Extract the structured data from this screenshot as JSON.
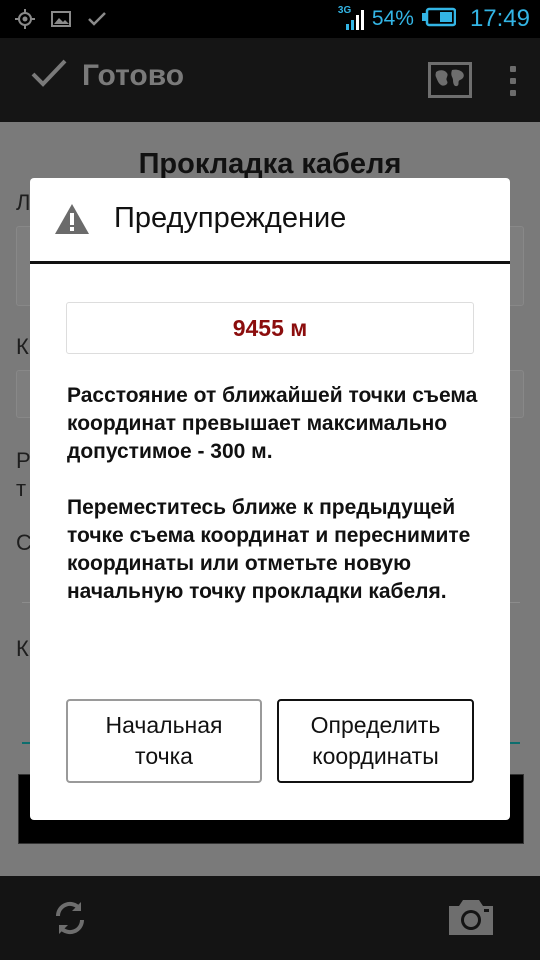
{
  "status_bar": {
    "icons": [
      "gps-icon",
      "image-icon",
      "check-icon"
    ],
    "network_label": "3G",
    "battery_percent": "54%",
    "time": "17:49",
    "accent_color": "#33b5e5"
  },
  "action_bar": {
    "done_label": "Готово",
    "map_icon": "world-map-icon",
    "more_icon": "overflow-menu-icon"
  },
  "form": {
    "title": "Прокладка кабеля",
    "label_fragments": [
      "Л",
      "К",
      "Р",
      "т",
      "С",
      "К"
    ]
  },
  "dialog": {
    "icon": "warning-icon",
    "title": "Предупреждение",
    "distance_value": "9455 м",
    "message_lines_1": "Расстояние от ближайшей точки съема координат превышает максимально допустимое - 300 м.",
    "message_lines_2": "Переместитесь ближе к предыдущей точке съема координат и переснимите координаты или отметьте новую начальную точку прокладки кабеля.",
    "button_start": "Начальная точка",
    "button_locate": "Определить координаты",
    "value_color": "#8b0d0d"
  },
  "bottom_bar": {
    "icons": [
      "sync-icon",
      "camera-icon"
    ]
  }
}
